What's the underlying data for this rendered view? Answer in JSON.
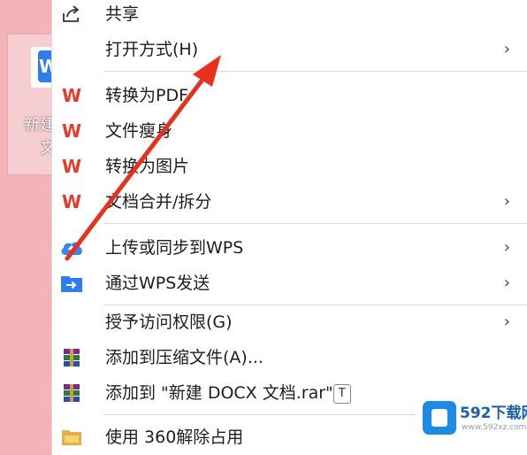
{
  "desktop_file": {
    "name_visible": "新建\n  文",
    "badge": "W"
  },
  "menu": {
    "items": [
      {
        "label": "共享",
        "icon": "share-icon",
        "submenu": false
      },
      {
        "label": "打开方式(H)",
        "icon": "",
        "submenu": true
      },
      {
        "label": "转换为PDF",
        "icon": "wps-icon",
        "submenu": false
      },
      {
        "label": "文件瘦身",
        "icon": "wps-icon",
        "submenu": false
      },
      {
        "label": "转换为图片",
        "icon": "wps-icon",
        "submenu": false
      },
      {
        "label": "文档合并/拆分",
        "icon": "wps-icon",
        "submenu": true
      },
      {
        "label": "上传或同步到WPS",
        "icon": "cloud-upload-icon",
        "submenu": true
      },
      {
        "label": "通过WPS发送",
        "icon": "send-icon",
        "submenu": true
      },
      {
        "label": "授予访问权限(G)",
        "icon": "",
        "submenu": true
      },
      {
        "label": "添加到压缩文件(A)...",
        "icon": "winrar-icon",
        "submenu": false
      },
      {
        "label": "添加到 \"新建 DOCX 文档.rar\"",
        "shortcut": "T",
        "icon": "winrar-icon",
        "submenu": false
      },
      {
        "label": "使用 360解除占用",
        "icon": "folder-icon",
        "submenu": false
      }
    ],
    "wps_glyph": "W",
    "chevron": "›"
  },
  "watermark": {
    "title": "592下载网",
    "subtitle": "www.592xz.com"
  },
  "colors": {
    "background": "#f4b3b8",
    "wps_red": "#e53b2c",
    "arrow_red": "#e8301f",
    "wps_blue": "#2f7bf0"
  }
}
